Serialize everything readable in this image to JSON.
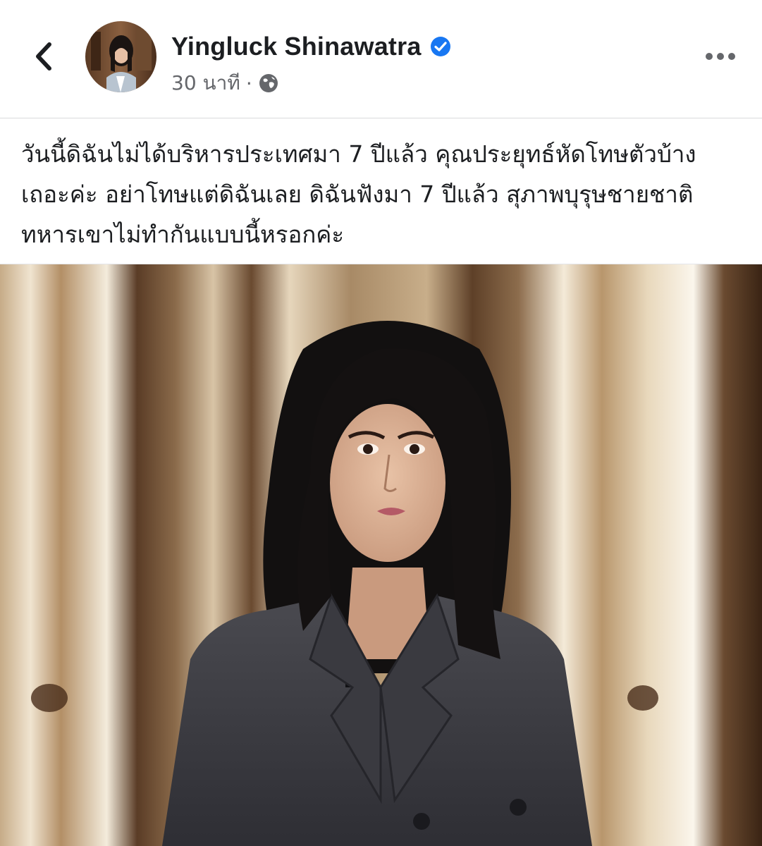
{
  "header": {
    "author_name": "Yingluck Shinawatra",
    "timestamp": "30 นาที",
    "separator": "·",
    "verified": true,
    "icons": {
      "back": "chevron-left-icon",
      "verified": "verified-badge-icon",
      "audience": "globe-icon",
      "more": "more-options-icon"
    }
  },
  "post": {
    "text": "วันนี้ดิฉันไม่ได้บริหารประเทศมา 7 ปีแล้ว คุณประยุทธ์หัดโทษตัวบ้างเถอะค่ะ อย่าโทษแต่ดิฉันเลย ดิฉันฟังมา 7 ปีแล้ว สุภาพบุรุษชายชาติทหารเขาไม่ทำกันแบบนี้หรอกค่ะ"
  },
  "colors": {
    "text_primary": "#1c1e21",
    "text_secondary": "#65676b",
    "verified_blue": "#1877f2"
  }
}
